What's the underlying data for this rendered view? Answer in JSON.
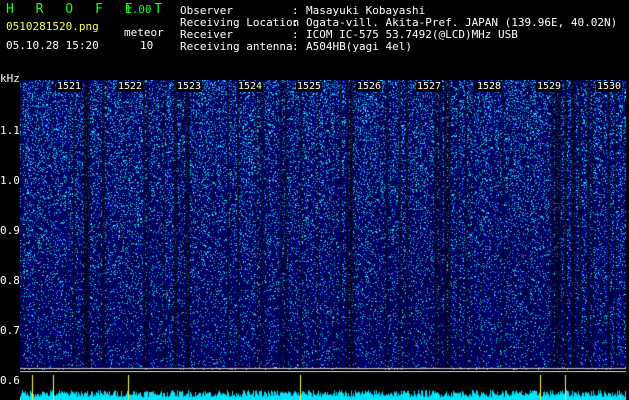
{
  "app": {
    "name": "H R O F F T",
    "version": "1.00"
  },
  "file": {
    "name": "0510281520.png",
    "datetime": "05.10.28 15:20"
  },
  "detection": {
    "label": "meteor",
    "count": "10"
  },
  "info": [
    {
      "label": "Observer",
      "value": "Masayuki Kobayashi"
    },
    {
      "label": "Receiving Location",
      "value": "Ogata-vill. Akita-Pref. JAPAN (139.96E, 40.02N)"
    },
    {
      "label": "Receiver",
      "value": "ICOM IC-575 53.7492(@LCD)MHz USB"
    },
    {
      "label": "Receiving antenna",
      "value": "A504HB(yagi 4el)"
    }
  ],
  "axis": {
    "unit": "kHz",
    "y_ticks": [
      "1.1",
      "1.0",
      "0.9",
      "0.8",
      "0.7",
      "0.6"
    ],
    "x_minutes": [
      "1521",
      "1522",
      "1523",
      "1524",
      "1525",
      "1526",
      "1527",
      "1528",
      "1529",
      "1530"
    ]
  },
  "colors": {
    "header_green": "#14ff14",
    "tick_yellow": "#ffff33",
    "signal_cyan": "#00e5ff"
  }
}
